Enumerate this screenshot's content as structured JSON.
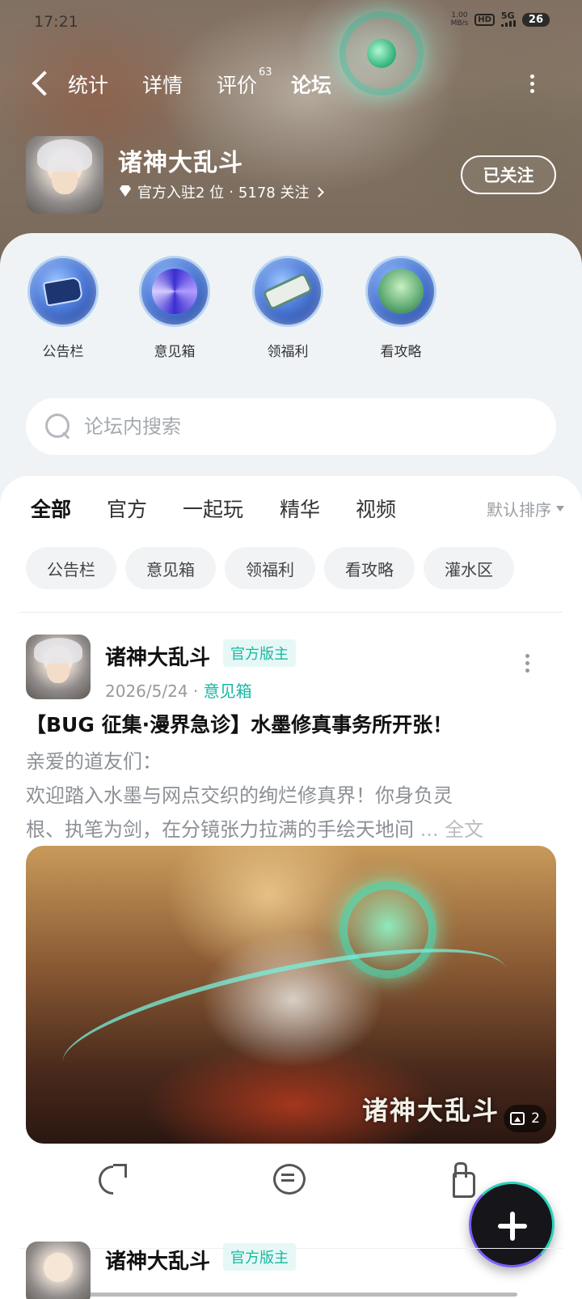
{
  "status_bar": {
    "time": "17:21",
    "net_speed": "1.00",
    "net_unit": "MB/s",
    "hd": "HD",
    "network": "5G",
    "battery": "26"
  },
  "nav": {
    "tabs": [
      {
        "label": "统计",
        "active": false
      },
      {
        "label": "详情",
        "active": false
      },
      {
        "label": "评价",
        "active": false,
        "count": "63"
      },
      {
        "label": "论坛",
        "active": true
      }
    ]
  },
  "game": {
    "name": "诸神大乱斗",
    "rank_text": "官方入驻2 位",
    "separator": "·",
    "followers_text": "5178 关注",
    "follow_button": "已关注"
  },
  "quick_links": [
    {
      "label": "公告栏",
      "icon": "bulletin-flag-icon"
    },
    {
      "label": "意见箱",
      "icon": "galaxy-icon"
    },
    {
      "label": "领福利",
      "icon": "scroll-icon"
    },
    {
      "label": "看攻略",
      "icon": "jade-cabbage-icon"
    }
  ],
  "search": {
    "placeholder": "论坛内搜索"
  },
  "feed_tabs": [
    {
      "label": "全部",
      "active": true
    },
    {
      "label": "官方",
      "active": false
    },
    {
      "label": "一起玩",
      "active": false
    },
    {
      "label": "精华",
      "active": false
    },
    {
      "label": "视频",
      "active": false
    }
  ],
  "sort_label": "默认排序",
  "chips": [
    "公告栏",
    "意见箱",
    "领福利",
    "看攻略",
    "灌水区"
  ],
  "post": {
    "author": "诸神大乱斗",
    "badge": "官方版主",
    "date": "2026/5/24",
    "dot": "·",
    "category": "意见箱",
    "title": "【BUG 征集·漫界急诊】水墨修真事务所开张！",
    "body_line1": "亲爱的道友们：",
    "body_line2": "欢迎踏入水墨与网点交织的绚烂修真界！你身负灵",
    "body_line3": "根、执笔为剑，在分镜张力拉满的手绘天地间",
    "ellipsis": " ... ",
    "read_more": "全文",
    "image_logo": "诸神大乱斗",
    "image_count": "2"
  },
  "post2": {
    "author": "诸神大乱斗",
    "badge": "官方版主"
  },
  "colors": {
    "accent": "#17c9b4",
    "badge_bg": "#e6f8f5",
    "badge_text": "#17b8a4"
  }
}
